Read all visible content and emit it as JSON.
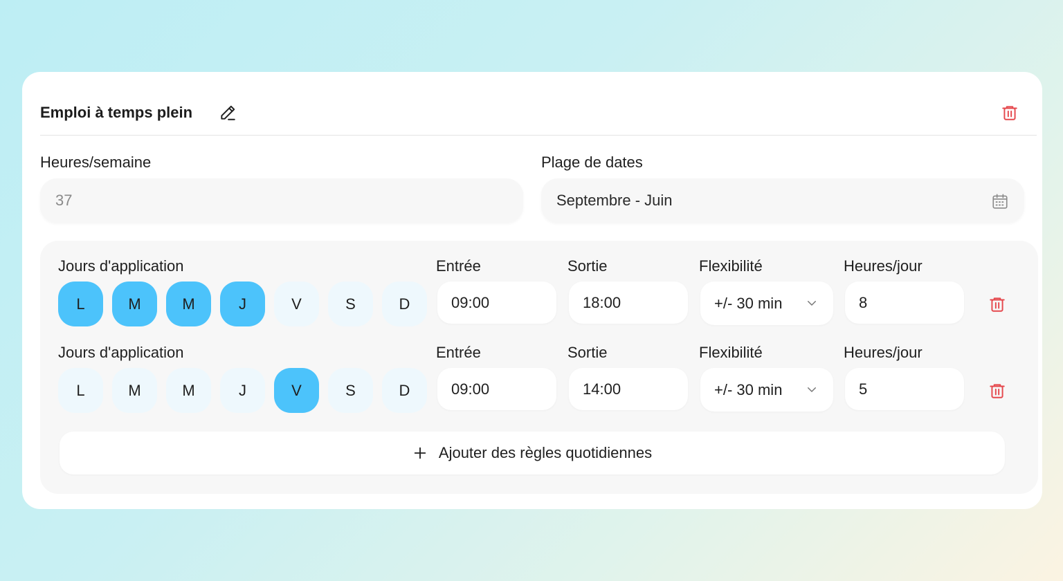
{
  "card": {
    "title": "Emploi à temps plein",
    "icons": {
      "edit": "pencil-icon",
      "delete": "trash-icon"
    }
  },
  "fields": {
    "hours_week": {
      "label": "Heures/semaine",
      "placeholder": "37"
    },
    "date_range": {
      "label": "Plage de dates",
      "value": "Septembre - Juin",
      "icon": "calendar-icon"
    }
  },
  "rules": [
    {
      "days_label": "Jours d'application",
      "days": [
        {
          "letter": "L",
          "active": true
        },
        {
          "letter": "M",
          "active": true
        },
        {
          "letter": "M",
          "active": true
        },
        {
          "letter": "J",
          "active": true
        },
        {
          "letter": "V",
          "active": false
        },
        {
          "letter": "S",
          "active": false
        },
        {
          "letter": "D",
          "active": false
        }
      ],
      "entry_label": "Entrée",
      "entry": "09:00",
      "exit_label": "Sortie",
      "exit": "18:00",
      "flex_label": "Flexibilité",
      "flex": "+/- 30 min",
      "hours_label": "Heures/jour",
      "hours": "8"
    },
    {
      "days_label": "Jours d'application",
      "days": [
        {
          "letter": "L",
          "active": false
        },
        {
          "letter": "M",
          "active": false
        },
        {
          "letter": "M",
          "active": false
        },
        {
          "letter": "J",
          "active": false
        },
        {
          "letter": "V",
          "active": true
        },
        {
          "letter": "S",
          "active": false
        },
        {
          "letter": "D",
          "active": false
        }
      ],
      "entry_label": "Entrée",
      "entry": "09:00",
      "exit_label": "Sortie",
      "exit": "14:00",
      "flex_label": "Flexibilité",
      "flex": "+/- 30 min",
      "hours_label": "Heures/jour",
      "hours": "5"
    }
  ],
  "add_rule_label": "Ajouter des règles quotidiennes",
  "colors": {
    "active_day": "#4cc3fb",
    "inactive_day": "#eef8fd",
    "danger": "#e5484d"
  }
}
